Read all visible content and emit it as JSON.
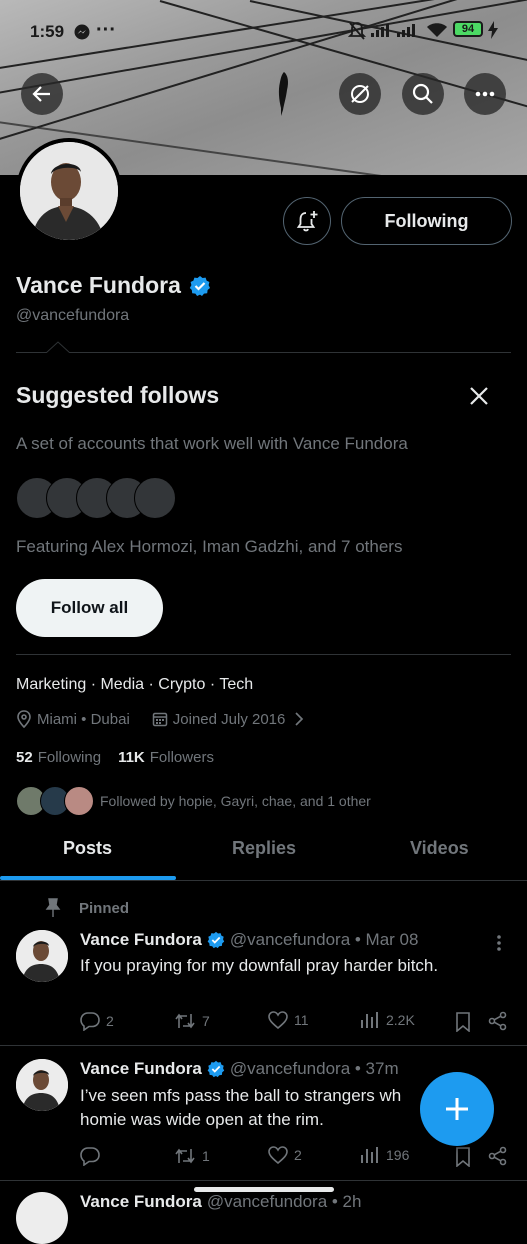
{
  "status_bar": {
    "time": "1:59",
    "battery": "94"
  },
  "profile": {
    "name": "Vance Fundora",
    "handle": "@vancefundora",
    "following_button": "Following",
    "bio": "Marketing · Media · Crypto · Tech",
    "location": "Miami • Dubai",
    "joined": "Joined July 2016",
    "following_count": "52",
    "following_label": "Following",
    "followers_count": "11K",
    "followers_label": "Followers",
    "followed_by": "Followed by hopie, Gayri, chae, and 1 other"
  },
  "suggested": {
    "title": "Suggested follows",
    "description": "A set of accounts that work well with Vance Fundora",
    "featuring": "Featuring Alex Hormozi, Iman Gadzhi, and 7 others",
    "follow_all": "Follow all"
  },
  "tabs": [
    {
      "label": "Posts",
      "active": true
    },
    {
      "label": "Replies",
      "active": false
    },
    {
      "label": "Videos",
      "active": false
    }
  ],
  "posts": [
    {
      "pinned_label": "Pinned",
      "name": "Vance Fundora",
      "meta": "@vancefundora • Mar 08",
      "text": "If you praying for my downfall pray harder bitch.",
      "replies": "2",
      "reposts": "7",
      "likes": "11",
      "views": "2.2K"
    },
    {
      "name": "Vance Fundora",
      "meta": "@vancefundora • 37m",
      "text_line1": "I’ve seen mfs pass the ball to strangers wh",
      "text_line2": "homie was wide open at the rim.",
      "replies": "",
      "reposts": "1",
      "likes": "2",
      "views": "196"
    },
    {
      "name": "Vance Fundora",
      "meta": "@vancefundora • 2h"
    }
  ],
  "colors": {
    "accent": "#1d9bf0",
    "muted": "#71767b",
    "divider": "#2f3336",
    "battery": "#4cd964"
  }
}
